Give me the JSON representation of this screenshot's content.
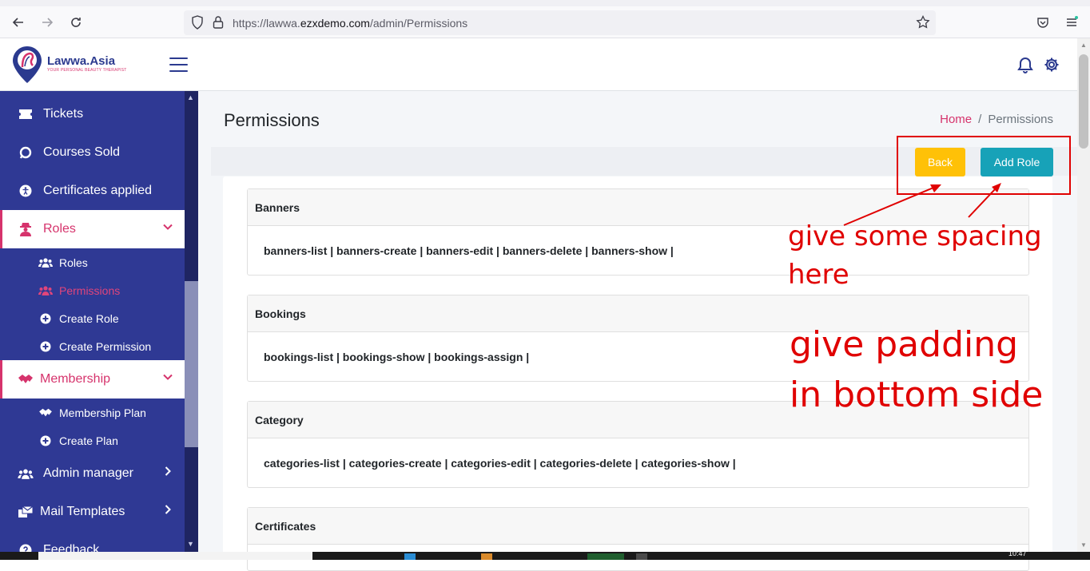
{
  "browser": {
    "url_prefix": "https://lawwa.",
    "url_host": "ezxdemo.com",
    "url_path": "/admin/Permissions",
    "clock": "10:47"
  },
  "header": {
    "logo_name": "Lawwa.Asia",
    "logo_tagline": "YOUR PERSONAL BEAUTY THERAPIST"
  },
  "sidebar": {
    "items": [
      {
        "label": "Tickets",
        "icon": "ticket-icon"
      },
      {
        "label": "Courses Sold",
        "icon": "chat-icon"
      },
      {
        "label": "Certificates applied",
        "icon": "accessibility-icon"
      },
      {
        "label": "Roles",
        "icon": "user-secret-icon",
        "active": true
      },
      {
        "label": "Membership",
        "icon": "hands-icon",
        "active": true
      },
      {
        "label": "Admin manager",
        "icon": "users-icon"
      },
      {
        "label": "Mail Templates",
        "icon": "mail-bulk-icon"
      },
      {
        "label": "Feedback",
        "icon": "question-icon"
      }
    ],
    "roles_sub": [
      {
        "label": "Roles",
        "icon": "users-icon"
      },
      {
        "label": "Permissions",
        "icon": "users-icon",
        "current": true
      },
      {
        "label": "Create Role",
        "icon": "plus-circle-icon"
      },
      {
        "label": "Create Permission",
        "icon": "plus-circle-icon"
      }
    ],
    "membership_sub": [
      {
        "label": "Membership Plan",
        "icon": "hands-icon"
      },
      {
        "label": "Create Plan",
        "icon": "plus-circle-icon"
      }
    ]
  },
  "main": {
    "title": "Permissions",
    "breadcrumb_home": "Home",
    "breadcrumb_sep": "/",
    "breadcrumb_current": "Permissions",
    "back_label": "Back",
    "add_role_label": "Add Role",
    "cards": [
      {
        "title": "Banners",
        "permissions": "banners-list | banners-create | banners-edit | banners-delete | banners-show |"
      },
      {
        "title": "Bookings",
        "permissions": "bookings-list | bookings-show | bookings-assign |"
      },
      {
        "title": "Category",
        "permissions": "categories-list | categories-create | categories-edit | categories-delete | categories-show |"
      },
      {
        "title": "Certificates",
        "permissions": ""
      }
    ]
  },
  "annotations": {
    "note1_line1": "give some spacing",
    "note1_line2": "here",
    "note2_line1": "give padding",
    "note2_line2": "in bottom side",
    "color": "#e00000"
  },
  "colors": {
    "sidebar_bg": "#2f3994",
    "accent_pink": "#d6336c",
    "back_btn": "#ffc107",
    "add_btn": "#17a2b8"
  }
}
